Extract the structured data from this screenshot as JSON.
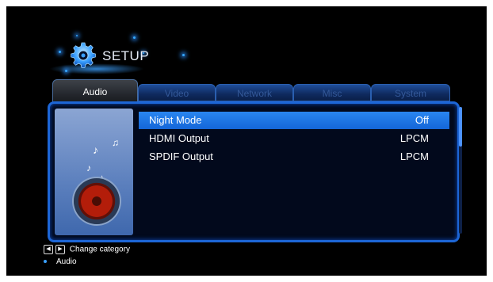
{
  "header": {
    "title": "SETUP"
  },
  "tabs": [
    {
      "label": "Audio",
      "active": true
    },
    {
      "label": "Video",
      "active": false
    },
    {
      "label": "Network",
      "active": false
    },
    {
      "label": "Misc",
      "active": false
    },
    {
      "label": "System",
      "active": false
    }
  ],
  "settings": [
    {
      "label": "Night Mode",
      "value": "Off",
      "selected": true
    },
    {
      "label": "HDMI Output",
      "value": "LPCM",
      "selected": false
    },
    {
      "label": "SPDIF Output",
      "value": "LPCM",
      "selected": false
    }
  ],
  "help": {
    "change_category": "Change category",
    "current_category": "Audio"
  },
  "icons": {
    "left_key": "arrow-left-icon",
    "right_key": "arrow-right-icon",
    "gear": "gear-icon",
    "speaker": "speaker-icon"
  },
  "colors": {
    "selection": "#1a73e8",
    "panel_border": "#1d66d6",
    "background": "#000000"
  }
}
